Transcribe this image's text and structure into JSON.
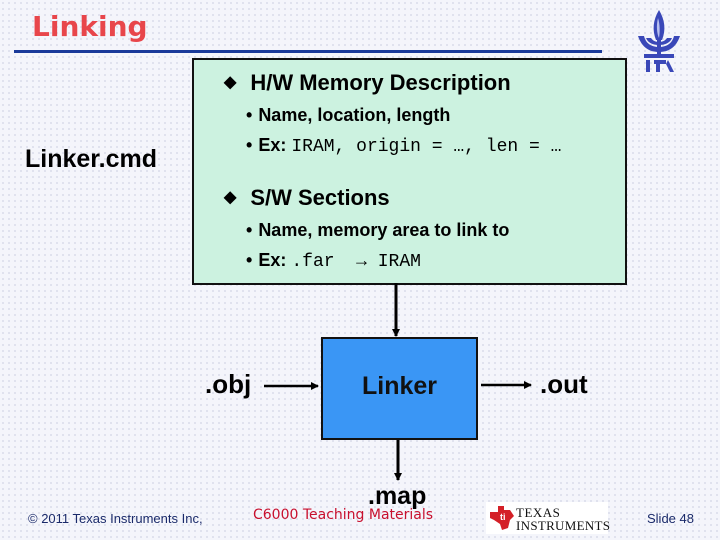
{
  "slide": {
    "title": "Linking",
    "left_label": "Linker.cmd",
    "panel": {
      "sections": [
        {
          "heading": "H/W Memory Description",
          "items": [
            {
              "label": "Name, location, length",
              "code": ""
            },
            {
              "label": "Ex:",
              "code": "IRAM, origin = …, len = …"
            }
          ]
        },
        {
          "heading": "S/W Sections",
          "items": [
            {
              "label": "Name, memory area to link to",
              "code": ""
            },
            {
              "label": "Ex:",
              "code": ".far  → IRAM"
            }
          ]
        }
      ]
    },
    "diagram": {
      "center_box": "Linker",
      "input": ".obj",
      "output": ".out",
      "map_output": ".map"
    }
  },
  "footer": {
    "copyright": "© 2011 Texas Instruments Inc,",
    "course": "C6000 Teaching Materials",
    "ti_logo": {
      "line1": "TEXAS",
      "line2": "INSTRUMENTS"
    },
    "slide_number": "Slide 48"
  },
  "colors": {
    "title": "#e8464b",
    "title_rule": "#1a3a9a",
    "panel_fill": "#ccf2e0",
    "linker_box": "#3a96f5",
    "footer_text": "#1a2a6a",
    "course_text": "#c8102e",
    "ti_red": "#d42027"
  }
}
